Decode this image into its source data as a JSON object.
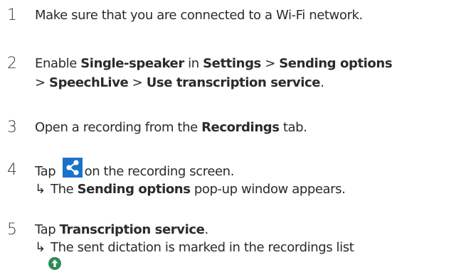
{
  "steps": [
    {
      "number": "1",
      "line1": "Make sure that you are connected to a Wi-Fi network."
    },
    {
      "number": "2",
      "t1": "Enable ",
      "b1": "Single-speaker",
      "t2": " in ",
      "b2": "Settings",
      "t3": " > ",
      "b3": "Sending options",
      "t4": "> ",
      "b4": "SpeechLive",
      "t5": " > ",
      "b5": "Use transcription service",
      "t6": "."
    },
    {
      "number": "3",
      "t1": "Open a recording from the ",
      "b1": "Recordings",
      "t2": " tab."
    },
    {
      "number": "4",
      "t1": "Tap ",
      "t2": "on the recording screen.",
      "arrow": "↳",
      "r1": "The ",
      "rb1": "Sending options",
      "r2": " pop-up window appears."
    },
    {
      "number": "5",
      "t1": "Tap ",
      "b1": "Transcription service",
      "t2": ".",
      "arrow": "↳",
      "r1": "The sent dictation is marked in the recordings list"
    }
  ],
  "icons": {
    "share": "share-icon",
    "upload": "upload-arrow-icon",
    "share_bg": "#1a73c8",
    "upload_bg": "#2e8b57"
  }
}
